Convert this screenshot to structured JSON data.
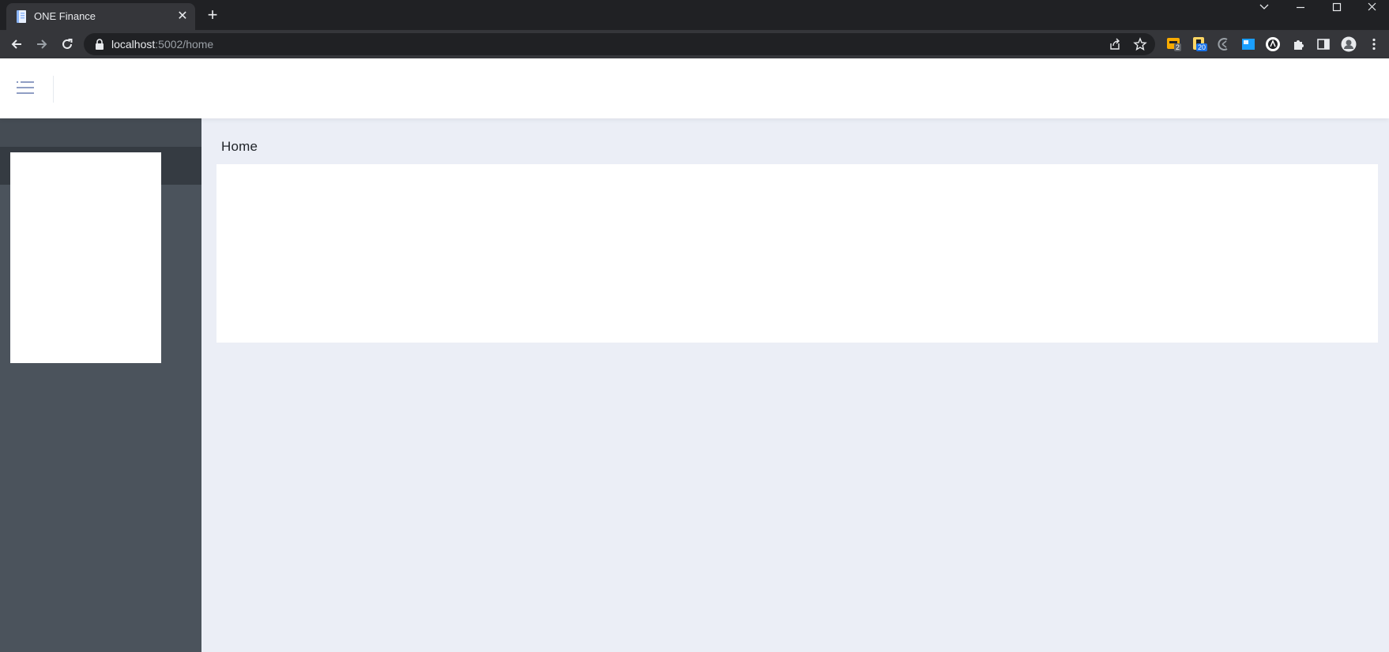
{
  "browser": {
    "tab": {
      "title": "ONE Finance",
      "close_glyph": "✕"
    },
    "new_tab_glyph": "+",
    "address": {
      "host": "localhost",
      "rest": ":5002/home"
    },
    "extensions": [
      {
        "name": "extension-1",
        "badge": "2",
        "badge_color": "#5f6368"
      },
      {
        "name": "extension-2",
        "badge": "20",
        "badge_color": "#1a73e8"
      }
    ]
  },
  "app": {
    "breadcrumb": "Home",
    "colors": {
      "sidebar": "#4b535c",
      "sidebar_active": "#353b42",
      "background": "#ebeef6",
      "menu_icon": "#6b7fb0"
    }
  }
}
